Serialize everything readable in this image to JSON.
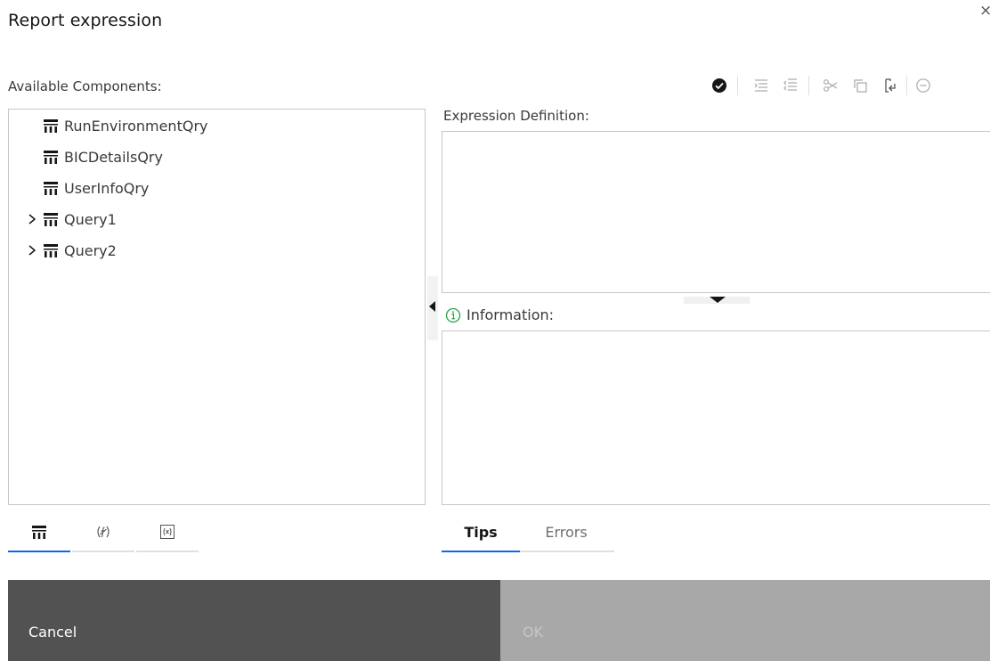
{
  "dialog": {
    "title": "Report expression",
    "close_symbol": "×"
  },
  "available_components": {
    "label": "Available Components:",
    "tree": [
      {
        "label": "RunEnvironmentQry",
        "expandable": false,
        "icon": "query-icon"
      },
      {
        "label": "BICDetailsQry",
        "expandable": false,
        "icon": "query-icon"
      },
      {
        "label": "UserInfoQry",
        "expandable": false,
        "icon": "query-icon"
      },
      {
        "label": "Query1",
        "expandable": true,
        "icon": "query-icon"
      },
      {
        "label": "Query2",
        "expandable": true,
        "icon": "query-icon"
      }
    ],
    "tabs": [
      {
        "name": "data-items-tab",
        "icon": "query-icon",
        "active": true
      },
      {
        "name": "functions-tab",
        "icon": "function-icon",
        "active": false
      },
      {
        "name": "parameters-tab",
        "icon": "parameter-icon",
        "active": false
      }
    ]
  },
  "toolbar": {
    "items": [
      "validate-icon",
      "indent-icon",
      "outdent-icon",
      "cut-icon",
      "copy-icon",
      "paste-icon",
      "remove-icon"
    ]
  },
  "expression": {
    "label": "Expression Definition:",
    "value": ""
  },
  "information": {
    "label": "Information:",
    "tabs": [
      {
        "label": "Tips",
        "active": true
      },
      {
        "label": "Errors",
        "active": false
      }
    ]
  },
  "footer": {
    "cancel_label": "Cancel",
    "ok_label": "OK"
  },
  "colors": {
    "accent": "#0f62fe",
    "info_green": "#24a148",
    "cancel_bg": "#525252",
    "ok_disabled_bg": "#a8a8a8"
  }
}
